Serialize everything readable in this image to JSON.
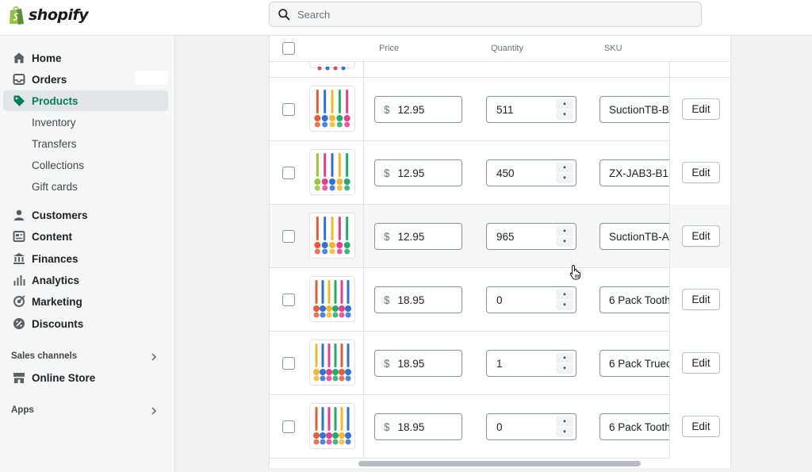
{
  "brand": {
    "name": "shopify",
    "color": "#95bf47"
  },
  "search": {
    "placeholder": "Search"
  },
  "sidebar": {
    "items": [
      {
        "label": "Home",
        "icon": "home-icon"
      },
      {
        "label": "Orders",
        "icon": "inbox-icon"
      },
      {
        "label": "Products",
        "icon": "tag-icon",
        "active": true
      },
      {
        "label": "Customers",
        "icon": "person-icon"
      },
      {
        "label": "Content",
        "icon": "content-icon"
      },
      {
        "label": "Finances",
        "icon": "bank-icon"
      },
      {
        "label": "Analytics",
        "icon": "bar-chart-icon"
      },
      {
        "label": "Marketing",
        "icon": "target-icon"
      },
      {
        "label": "Discounts",
        "icon": "discount-icon"
      }
    ],
    "product_subitems": [
      "Inventory",
      "Transfers",
      "Collections",
      "Gift cards"
    ],
    "sales_channels_label": "Sales channels",
    "online_store_label": "Online Store",
    "apps_label": "Apps",
    "active_color": "#007f5f"
  },
  "table": {
    "headers": {
      "price": "Price",
      "quantity": "Quantity",
      "sku": "SKU"
    },
    "currency": "$",
    "edit_label": "Edit",
    "rows": [
      {
        "price": "12.95",
        "quantity": "511",
        "sku": "SuctionTB-B"
      },
      {
        "price": "12.95",
        "quantity": "450",
        "sku": "ZX-JAB3-B1"
      },
      {
        "price": "12.95",
        "quantity": "965",
        "sku": "SuctionTB-A"
      },
      {
        "price": "18.95",
        "quantity": "0",
        "sku": "6 Pack Tooth"
      },
      {
        "price": "18.95",
        "quantity": "1",
        "sku": "6 Pack Truec"
      },
      {
        "price": "18.95",
        "quantity": "0",
        "sku": "6 Pack Tooth"
      }
    ]
  }
}
